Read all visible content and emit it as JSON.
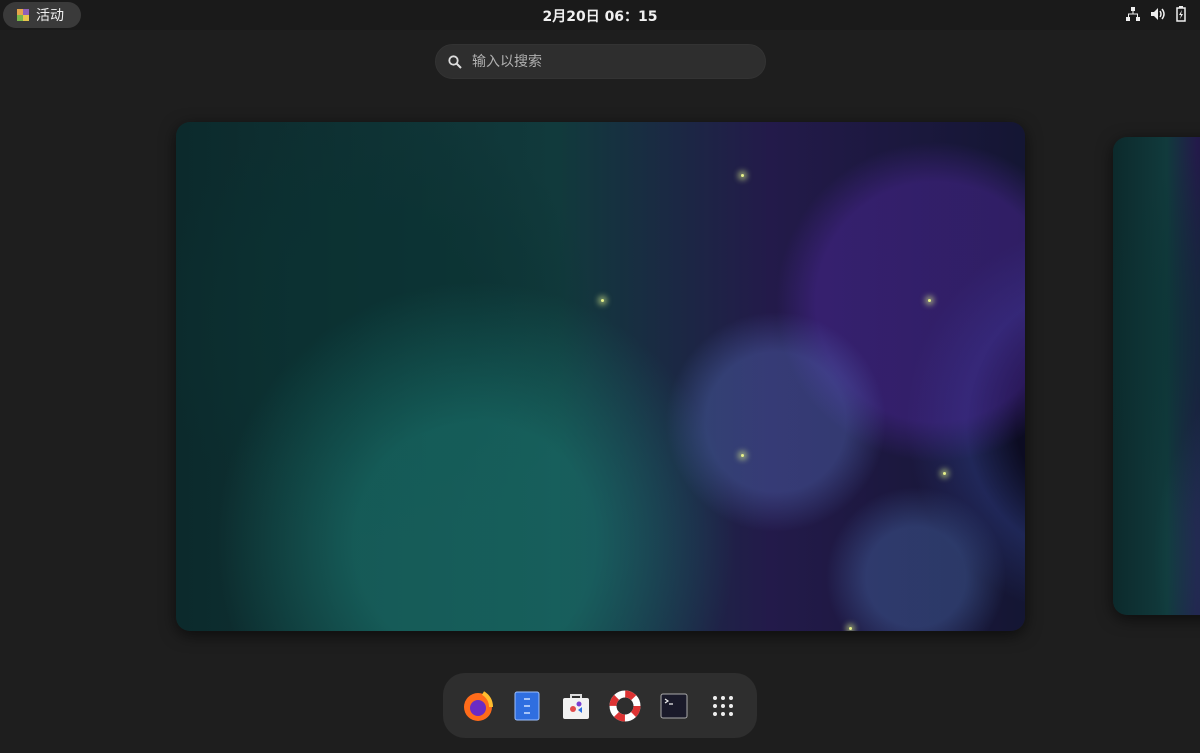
{
  "topbar": {
    "activities_label": "活动",
    "clock": "2月20日  06：15"
  },
  "search": {
    "placeholder": "输入以搜索",
    "value": ""
  },
  "dock": {
    "items": [
      {
        "name": "Firefox",
        "icon": "firefox-icon"
      },
      {
        "name": "Files",
        "icon": "files-icon"
      },
      {
        "name": "Software",
        "icon": "software-icon"
      },
      {
        "name": "Help",
        "icon": "help-icon"
      },
      {
        "name": "Terminal",
        "icon": "terminal-icon"
      },
      {
        "name": "Show Applications",
        "icon": "app-grid-icon"
      }
    ]
  },
  "colors": {
    "background": "#1e1e1e",
    "panel": "#2e2e2e"
  }
}
